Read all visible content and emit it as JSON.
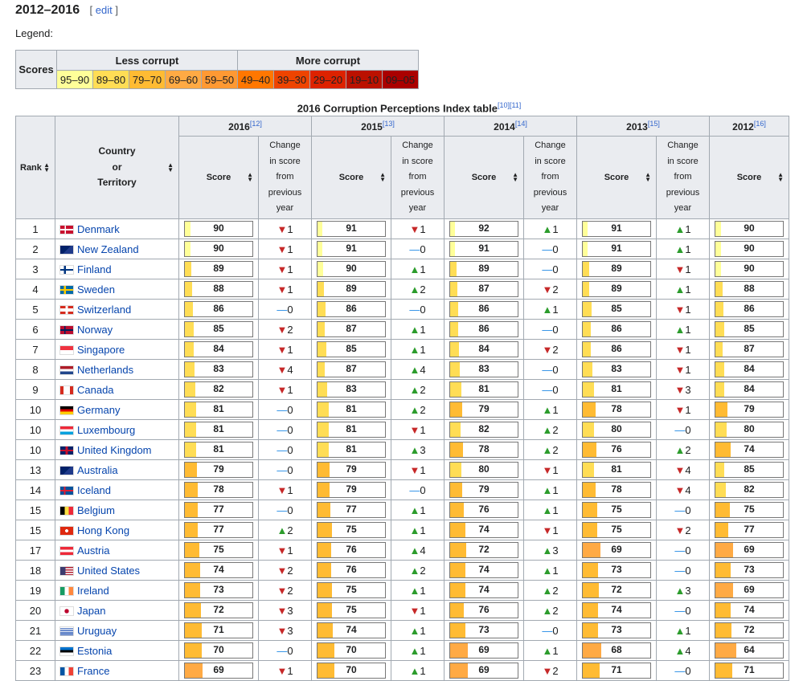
{
  "heading": {
    "title": "2012–2016",
    "edit_label": "edit"
  },
  "legend": {
    "label": "Legend:",
    "scores_label": "Scores",
    "less_corrupt": "Less corrupt",
    "more_corrupt": "More corrupt",
    "bands": [
      {
        "label": "95–90",
        "color": "#ffff99"
      },
      {
        "label": "89–80",
        "color": "#ffdd55"
      },
      {
        "label": "79–70",
        "color": "#ffbb33"
      },
      {
        "label": "69–60",
        "color": "#ffaa44"
      },
      {
        "label": "59–50",
        "color": "#ff9933"
      },
      {
        "label": "49–40",
        "color": "#ff7700"
      },
      {
        "label": "39–30",
        "color": "#ee4400"
      },
      {
        "label": "29–20",
        "color": "#dd2200"
      },
      {
        "label": "19–10",
        "color": "#bb1100"
      },
      {
        "label": "09–05",
        "color": "#aa0000"
      }
    ]
  },
  "table": {
    "caption": "2016 Corruption Perceptions Index table",
    "caption_refs": "[10][11]",
    "rank_header": "Rank",
    "country_header": [
      "Country",
      "or",
      "Territory"
    ],
    "score_header": "Score",
    "change_header": [
      "Change",
      "in score",
      "from",
      "previous",
      "year"
    ],
    "years": [
      {
        "year": "2016",
        "ref": "[12]"
      },
      {
        "year": "2015",
        "ref": "[13]"
      },
      {
        "year": "2014",
        "ref": "[14]"
      },
      {
        "year": "2013",
        "ref": "[15]"
      },
      {
        "year": "2012",
        "ref": "[16]"
      }
    ],
    "rows": [
      {
        "rank": "1",
        "country": "Denmark",
        "flag": "dk",
        "s": [
          90,
          91,
          92,
          91,
          90
        ],
        "c": [
          "−1",
          "−1",
          "+1",
          "+1"
        ]
      },
      {
        "rank": "2",
        "country": "New Zealand",
        "flag": "nz",
        "s": [
          90,
          91,
          91,
          91,
          90
        ],
        "c": [
          "−1",
          "−0",
          "−0",
          "+1"
        ]
      },
      {
        "rank": "3",
        "country": "Finland",
        "flag": "fi",
        "s": [
          89,
          90,
          89,
          89,
          90
        ],
        "c": [
          "−1",
          "+1",
          "−0",
          "−1"
        ]
      },
      {
        "rank": "4",
        "country": "Sweden",
        "flag": "se",
        "s": [
          88,
          89,
          87,
          89,
          88
        ],
        "c": [
          "−1",
          "+2",
          "−2",
          "+1"
        ]
      },
      {
        "rank": "5",
        "country": "Switzerland",
        "flag": "ch",
        "s": [
          86,
          86,
          86,
          85,
          86
        ],
        "c": [
          "0",
          "−0",
          "+1",
          "−1"
        ]
      },
      {
        "rank": "6",
        "country": "Norway",
        "flag": "no",
        "s": [
          85,
          87,
          86,
          86,
          85
        ],
        "c": [
          "−2",
          "+1",
          "−0",
          "+1"
        ]
      },
      {
        "rank": "7",
        "country": "Singapore",
        "flag": "sg",
        "s": [
          84,
          85,
          84,
          86,
          87
        ],
        "c": [
          "−1",
          "+1",
          "−2",
          "−1"
        ]
      },
      {
        "rank": "8",
        "country": "Netherlands",
        "flag": "nl",
        "s": [
          83,
          87,
          83,
          83,
          84
        ],
        "c": [
          "−4",
          "+4",
          "−0",
          "−1"
        ]
      },
      {
        "rank": "9",
        "country": "Canada",
        "flag": "ca",
        "s": [
          82,
          83,
          81,
          81,
          84
        ],
        "c": [
          "−1",
          "+2",
          "−0",
          "−3"
        ]
      },
      {
        "rank": "10",
        "country": "Germany",
        "flag": "de",
        "s": [
          81,
          81,
          79,
          78,
          79
        ],
        "c": [
          "−0",
          "+2",
          "+1",
          "−1"
        ]
      },
      {
        "rank": "10",
        "country": "Luxembourg",
        "flag": "lu",
        "s": [
          81,
          81,
          82,
          80,
          80
        ],
        "c": [
          "0",
          "−1",
          "+2",
          "−0"
        ]
      },
      {
        "rank": "10",
        "country": "United Kingdom",
        "flag": "gb",
        "s": [
          81,
          81,
          78,
          76,
          74
        ],
        "c": [
          "−0",
          "+3",
          "+2",
          "+2"
        ]
      },
      {
        "rank": "13",
        "country": "Australia",
        "flag": "au",
        "s": [
          79,
          79,
          80,
          81,
          85
        ],
        "c": [
          "−0",
          "−1",
          "−1",
          "−4"
        ]
      },
      {
        "rank": "14",
        "country": "Iceland",
        "flag": "is",
        "s": [
          78,
          79,
          79,
          78,
          82
        ],
        "c": [
          "−1",
          "−0",
          "+1",
          "−4"
        ]
      },
      {
        "rank": "15",
        "country": "Belgium",
        "flag": "be",
        "s": [
          77,
          77,
          76,
          75,
          75
        ],
        "c": [
          "−0",
          "+1",
          "+1",
          "−0"
        ]
      },
      {
        "rank": "15",
        "country": "Hong Kong",
        "flag": "hk",
        "s": [
          77,
          75,
          74,
          75,
          77
        ],
        "c": [
          "+2",
          "+1",
          "−1",
          "−2"
        ]
      },
      {
        "rank": "17",
        "country": "Austria",
        "flag": "at",
        "s": [
          75,
          76,
          72,
          69,
          69
        ],
        "c": [
          "−1",
          "+4",
          "+3",
          "−0"
        ]
      },
      {
        "rank": "18",
        "country": "United States",
        "flag": "us",
        "s": [
          74,
          76,
          74,
          73,
          73
        ],
        "c": [
          "−2",
          "+2",
          "+1",
          "−0"
        ]
      },
      {
        "rank": "19",
        "country": "Ireland",
        "flag": "ie",
        "s": [
          73,
          75,
          74,
          72,
          69
        ],
        "c": [
          "−2",
          "+1",
          "+2",
          "+3"
        ]
      },
      {
        "rank": "20",
        "country": "Japan",
        "flag": "jp",
        "s": [
          72,
          75,
          76,
          74,
          74
        ],
        "c": [
          "−3",
          "−1",
          "+2",
          "−0"
        ]
      },
      {
        "rank": "21",
        "country": "Uruguay",
        "flag": "uy",
        "s": [
          71,
          74,
          73,
          73,
          72
        ],
        "c": [
          "−3",
          "+1",
          "−0",
          "+1"
        ]
      },
      {
        "rank": "22",
        "country": "Estonia",
        "flag": "ee",
        "s": [
          70,
          70,
          69,
          68,
          64
        ],
        "c": [
          "−0",
          "+1",
          "+1",
          "+4"
        ]
      },
      {
        "rank": "23",
        "country": "France",
        "flag": "fr",
        "s": [
          69,
          70,
          69,
          71,
          71
        ],
        "c": [
          "−1",
          "+1",
          "−2",
          "−0"
        ]
      }
    ]
  }
}
